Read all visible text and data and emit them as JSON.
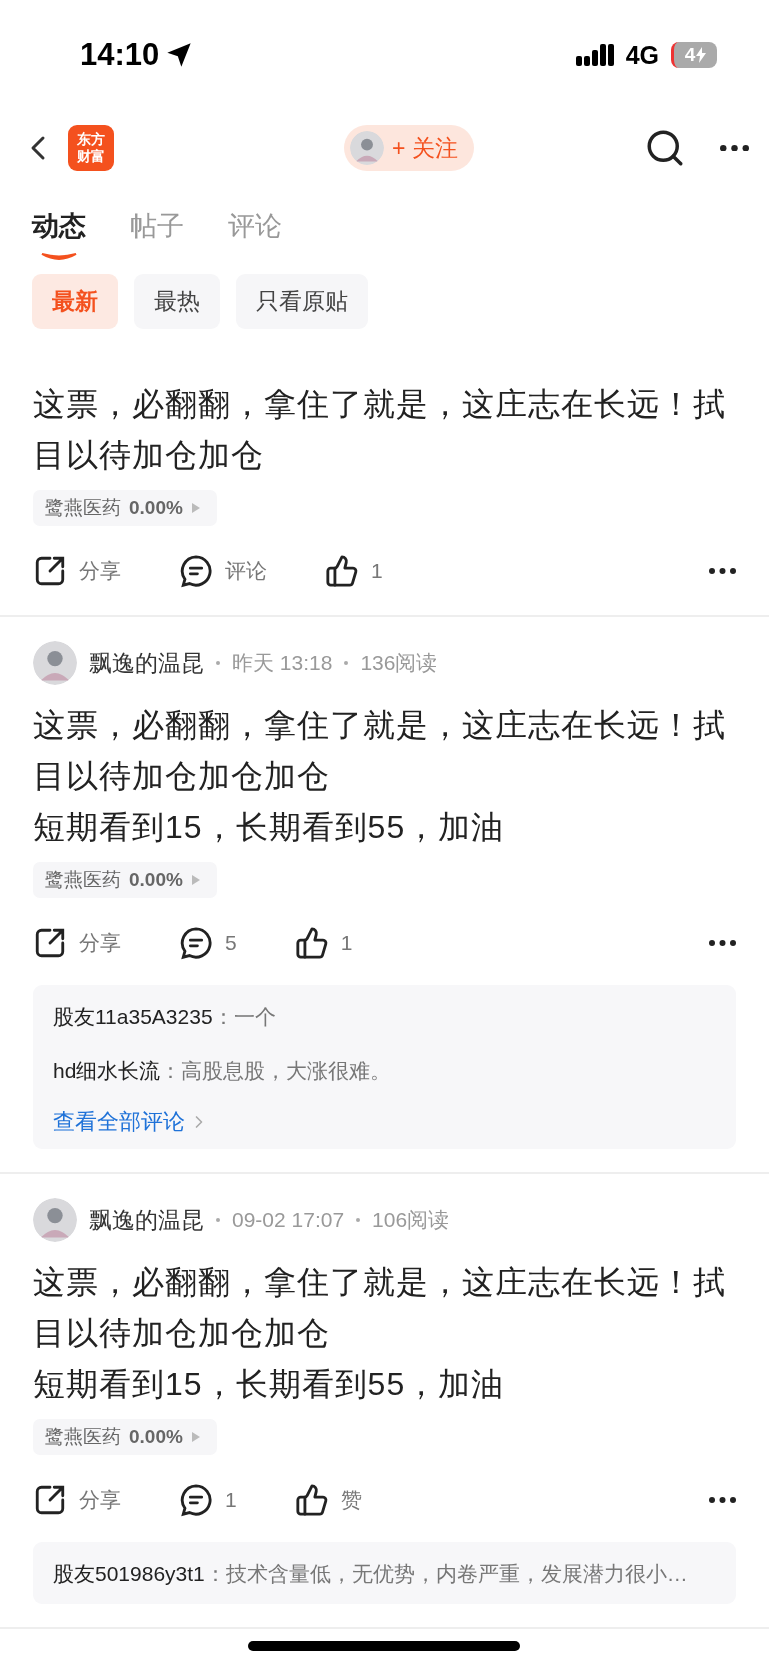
{
  "status_bar": {
    "time": "14:10",
    "network": "4G",
    "battery": "4"
  },
  "nav": {
    "logo": [
      "东方",
      "财富"
    ],
    "follow": "+ 关注"
  },
  "tabs": [
    {
      "label": "动态",
      "selected": true
    },
    {
      "label": "帖子",
      "selected": false
    },
    {
      "label": "评论",
      "selected": false
    }
  ],
  "filters": [
    {
      "label": "最新",
      "selected": true
    },
    {
      "label": "最热",
      "selected": false
    },
    {
      "label": "只看原贴",
      "selected": false
    }
  ],
  "posts": [
    {
      "paragraphs": [
        "这票，必翻翻，拿住了就是，这庄志在长远！拭目以待加仓加仓"
      ],
      "stock": {
        "name": "鹭燕医药",
        "change": "0.00%"
      },
      "actions": {
        "share": "分享",
        "comment": "评论",
        "like": "1"
      }
    },
    {
      "author": "飘逸的温昆",
      "meta": [
        "昨天 13:18",
        "136阅读"
      ],
      "paragraphs": [
        "这票，必翻翻，拿住了就是，这庄志在长远！拭目以待加仓加仓加仓",
        "短期看到15，长期看到55，加油"
      ],
      "stock": {
        "name": "鹭燕医药",
        "change": "0.00%"
      },
      "actions": {
        "share": "分享",
        "comment": "5",
        "like": "1"
      },
      "comments": [
        "**股友11a35A3235**：一个",
        "**hd细水长流**：高股息股，大涨很难。"
      ],
      "more_link": "查看全部评论"
    },
    {
      "author": "飘逸的温昆",
      "meta": [
        "09-02 17:07",
        "106阅读"
      ],
      "paragraphs": [
        "这票，必翻翻，拿住了就是，这庄志在长远！拭目以待加仓加仓加仓",
        "短期看到15，长期看到55，加油"
      ],
      "stock": {
        "name": "鹭燕医药",
        "change": "0.00%"
      },
      "actions": {
        "share": "分享",
        "comment": "1",
        "like": "赞"
      },
      "comments": [
        "**股友501986y3t1**：技术含量低，无优势，内卷严重，发展潜力很小…"
      ]
    }
  ]
}
